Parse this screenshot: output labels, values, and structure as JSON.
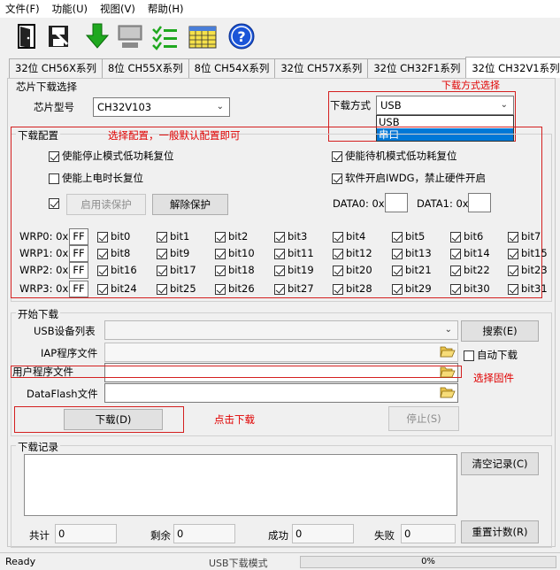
{
  "menu": [
    "文件(F)",
    "功能(U)",
    "视图(V)",
    "帮助(H)"
  ],
  "toolbar_icons": [
    "door-icon",
    "save-icon",
    "download-arrow-icon",
    "computer-icon",
    "checklist-icon",
    "calendar-icon",
    "help-icon"
  ],
  "tabs": [
    {
      "label": "32位 CH56X系列",
      "active": false
    },
    {
      "label": "8位 CH55X系列",
      "active": false
    },
    {
      "label": "8位 CH54X系列",
      "active": false
    },
    {
      "label": "32位 CH57X系列",
      "active": false
    },
    {
      "label": "32位 CH32F1系列",
      "active": false
    },
    {
      "label": "32位 CH32V1系列",
      "active": true
    }
  ],
  "chip": {
    "group_label": "芯片下载选择",
    "model_label": "芯片型号",
    "model_value": "CH32V103",
    "mode_label": "下载方式",
    "mode_value": "USB",
    "mode_options": [
      "USB",
      "串口"
    ],
    "mode_highlighted": "串口",
    "annotation": "下载方式选择"
  },
  "config": {
    "group_label": "下载配置",
    "annotation": "选择配置，一般默认配置即可",
    "opt1": {
      "label": "使能停止模式低功耗复位",
      "checked": true
    },
    "opt2": {
      "label": "使能待机模式低功耗复位",
      "checked": true
    },
    "opt3": {
      "label": "使能上电时长复位",
      "checked": false
    },
    "opt4": {
      "label": "软件开启IWDG，禁止硬件开启",
      "checked": true
    },
    "read_protect_checked": true,
    "enable_read_protect": "启用读保护",
    "remove_protect": "解除保护",
    "data0_label": "DATA0: 0x",
    "data0_value": "",
    "data1_label": "DATA1: 0x",
    "data1_value": ""
  },
  "wrp": [
    {
      "label": "WRP0: 0x",
      "value": "FF",
      "bits": [
        "bit0",
        "bit1",
        "bit2",
        "bit3",
        "bit4",
        "bit5",
        "bit6",
        "bit7"
      ]
    },
    {
      "label": "WRP1: 0x",
      "value": "FF",
      "bits": [
        "bit8",
        "bit9",
        "bit10",
        "bit11",
        "bit12",
        "bit13",
        "bit14",
        "bit15"
      ]
    },
    {
      "label": "WRP2: 0x",
      "value": "FF",
      "bits": [
        "bit16",
        "bit17",
        "bit18",
        "bit19",
        "bit20",
        "bit21",
        "bit22",
        "bit23"
      ]
    },
    {
      "label": "WRP3: 0x",
      "value": "FF",
      "bits": [
        "bit24",
        "bit25",
        "bit26",
        "bit27",
        "bit28",
        "bit29",
        "bit30",
        "bit31"
      ]
    }
  ],
  "download": {
    "group_label": "开始下载",
    "usb_list_label": "USB设备列表",
    "search_button": "搜索(E)",
    "iap_label": "IAP程序文件",
    "auto_download_label": "自动下载",
    "auto_download_checked": false,
    "user_label": "用户程序文件",
    "user_annotation": "选择固件",
    "dataflash_label": "DataFlash文件",
    "download_button": "下载(D)",
    "download_annotation": "点击下载",
    "stop_button": "停止(S)"
  },
  "log": {
    "group_label": "下载记录",
    "clear_button": "清空记录(C)",
    "total_label": "共计",
    "total_value": "0",
    "remain_label": "剩余",
    "remain_value": "0",
    "success_label": "成功",
    "success_value": "0",
    "fail_label": "失败",
    "fail_value": "0",
    "reset_button": "重置计数(R)"
  },
  "status": {
    "ready": "Ready",
    "mode": "USB下载模式",
    "progress_text": "0%",
    "progress_value": 0
  },
  "colors": {
    "annotation_red": "#e00000",
    "selection_blue": "#0078d7"
  }
}
